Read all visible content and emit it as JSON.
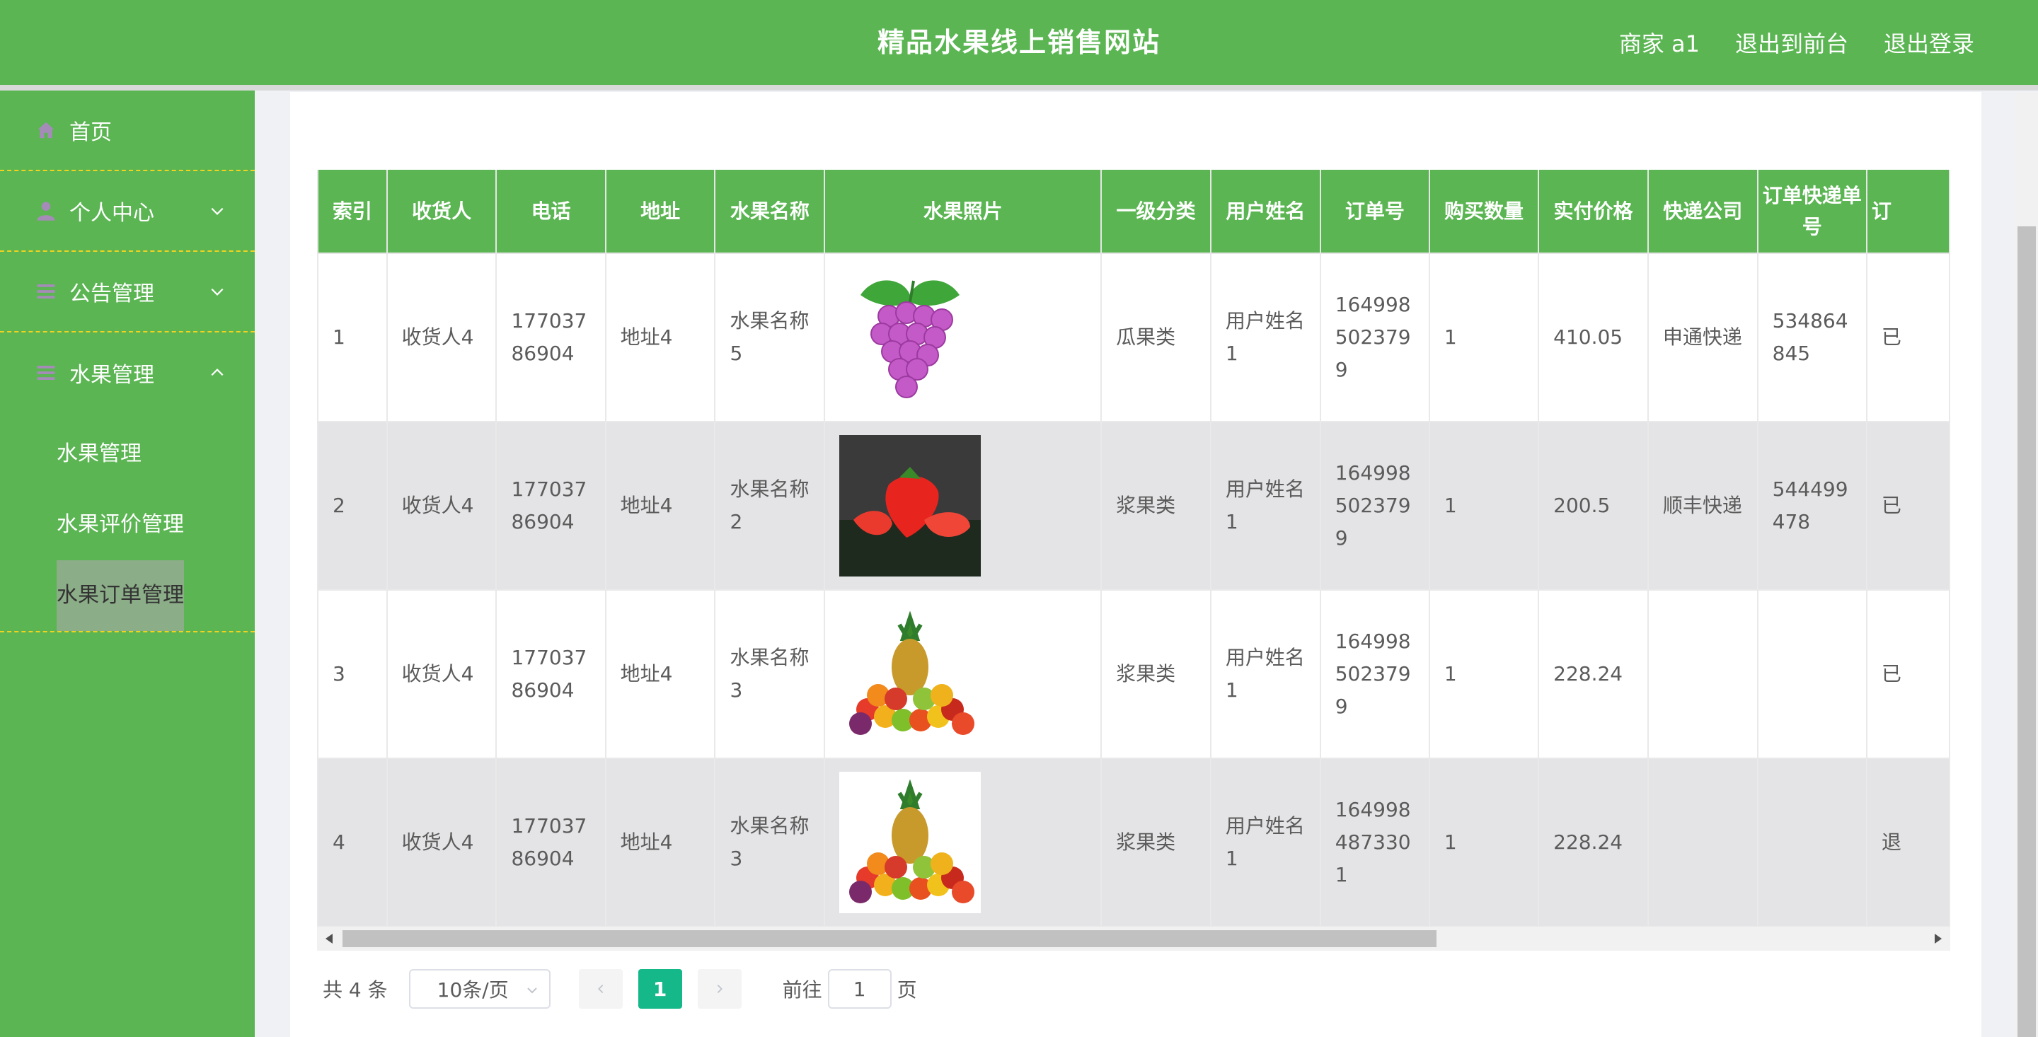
{
  "header": {
    "title": "精品水果线上销售网站",
    "user": "商家 a1",
    "to_front": "退出到前台",
    "logout": "退出登录"
  },
  "sidebar": {
    "items": [
      {
        "label": "首页",
        "icon": "home-icon"
      },
      {
        "label": "个人中心",
        "icon": "user-icon"
      },
      {
        "label": "公告管理",
        "icon": "list-icon"
      },
      {
        "label": "水果管理",
        "icon": "list-icon"
      }
    ],
    "sub_items": [
      {
        "label": "水果管理"
      },
      {
        "label": "水果评价管理"
      },
      {
        "label": "水果订单管理"
      }
    ]
  },
  "table": {
    "columns": [
      "索引",
      "收货人",
      "电话",
      "地址",
      "水果名称",
      "水果照片",
      "一级分类",
      "用户姓名",
      "订单号",
      "购买数量",
      "实付价格",
      "快递公司",
      "订单快递单号",
      "订"
    ],
    "rows": [
      {
        "idx": "1",
        "receiver": "收货人4",
        "phone": "17703786904",
        "address": "地址4",
        "fruit": "水果名称5",
        "photo": "grape",
        "category": "瓜果类",
        "user": "用户姓名1",
        "order": "1649985023799",
        "qty": "1",
        "price": "410.05",
        "express": "申通快递",
        "tracking": "534864845",
        "status": "已"
      },
      {
        "idx": "2",
        "receiver": "收货人4",
        "phone": "17703786904",
        "address": "地址4",
        "fruit": "水果名称2",
        "photo": "strawberry",
        "category": "浆果类",
        "user": "用户姓名1",
        "order": "1649985023799",
        "qty": "1",
        "price": "200.5",
        "express": "顺丰快递",
        "tracking": "544499478",
        "status": "已"
      },
      {
        "idx": "3",
        "receiver": "收货人4",
        "phone": "17703786904",
        "address": "地址4",
        "fruit": "水果名称3",
        "photo": "mixed",
        "category": "浆果类",
        "user": "用户姓名1",
        "order": "1649985023799",
        "qty": "1",
        "price": "228.24",
        "express": "",
        "tracking": "",
        "status": "已"
      },
      {
        "idx": "4",
        "receiver": "收货人4",
        "phone": "17703786904",
        "address": "地址4",
        "fruit": "水果名称3",
        "photo": "mixed",
        "category": "浆果类",
        "user": "用户姓名1",
        "order": "1649984873301",
        "qty": "1",
        "price": "228.24",
        "express": "",
        "tracking": "",
        "status": "退"
      }
    ]
  },
  "pager": {
    "total": "共 4 条",
    "page_size": "10条/页",
    "current": "1",
    "goto_label": "前往",
    "goto_value": "1",
    "page_unit": "页"
  },
  "colors": {
    "primary": "#5ab552",
    "accent": "#14b889",
    "divider": "#f2d21f"
  }
}
